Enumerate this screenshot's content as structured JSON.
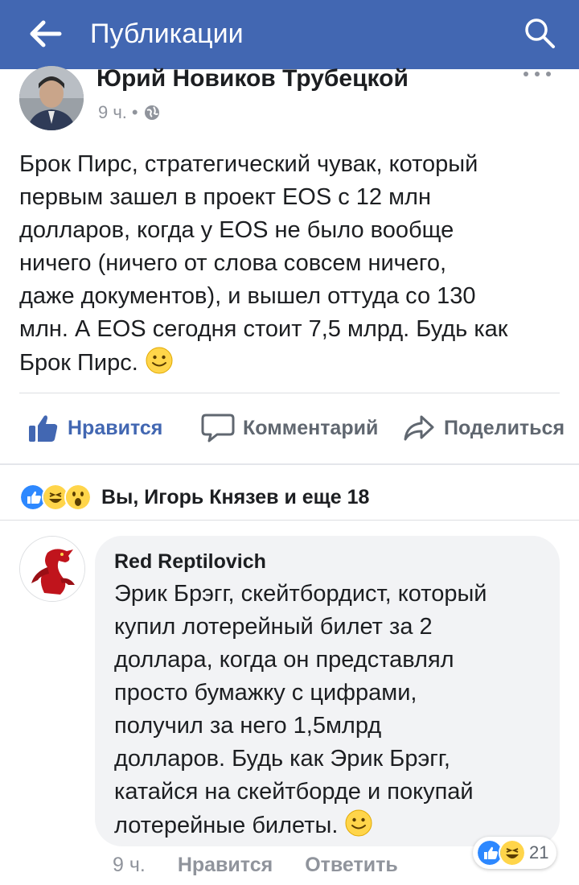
{
  "header": {
    "title": "Публикации",
    "back_icon": "arrow-left-icon",
    "search_icon": "search-icon"
  },
  "post": {
    "author": "Юрий Новиков Трубецкой",
    "time": "9 ч.",
    "separator": "•",
    "privacy_icon": "globe-icon",
    "text": "Брок Пирс, стратегический чувак, который\nпервым зашел в проект EOS с 12 млн\nдолларов, когда у EOS не было вообще\nничего (ничего от слова совсем ничего,\nдаже документов), и вышел оттуда со 130\nмлн. А EOS сегодня стоит 7,5 млрд. Будь как\nБрок Пирс."
  },
  "actions": {
    "like": "Нравится",
    "comment": "Комментарий",
    "share": "Поделиться"
  },
  "reactions": {
    "summary": "Вы, Игорь Князев и еще 18",
    "icons": [
      "like-reaction-icon",
      "haha-reaction-icon",
      "wow-reaction-icon"
    ]
  },
  "comment": {
    "author": "Red Reptilovich",
    "text": "Эрик Брэгг, скейтбордист, который\nкупил лотерейный билет за 2\nдоллара, когда он представлял\nпросто бумажку с цифрами,\nполучил за него 1,5млрд\nдолларов. Будь как Эрик Брэгг,\nкатайся на скейтборде и покупай\nлотерейные билеты.",
    "time": "9 ч.",
    "like": "Нравится",
    "reply": "Ответить",
    "reaction_count": "21"
  },
  "colors": {
    "brand": "#4267b2",
    "muted": "#90949c",
    "bubble": "#f2f3f5"
  }
}
